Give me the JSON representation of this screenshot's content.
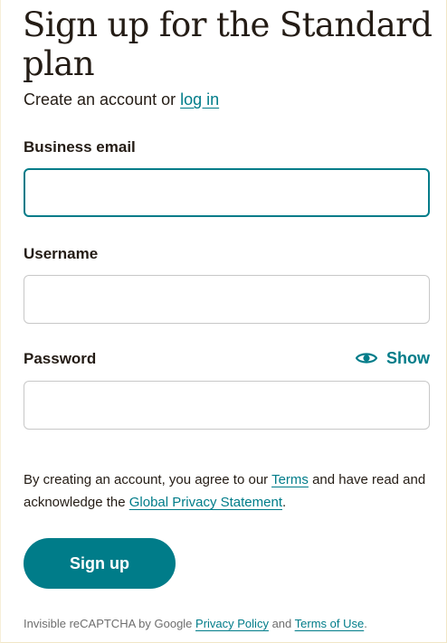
{
  "header": {
    "title": "Sign up for the Standard plan",
    "subtitle_text": "Create an account or ",
    "login_link": "log in"
  },
  "form": {
    "email": {
      "label": "Business email",
      "value": "",
      "placeholder": ""
    },
    "username": {
      "label": "Username",
      "value": "",
      "placeholder": ""
    },
    "password": {
      "label": "Password",
      "value": "",
      "placeholder": "",
      "toggle_label": "Show",
      "toggle_icon": "eye-icon"
    }
  },
  "legal": {
    "text_before": "By creating an account, you agree to our ",
    "terms_link": "Terms",
    "text_middle": " and have read and acknowledge the ",
    "privacy_link": "Global Privacy Statement",
    "text_after": "."
  },
  "submit": {
    "label": "Sign up"
  },
  "recaptcha": {
    "text_before": "Invisible reCAPTCHA by Google ",
    "privacy_link": "Privacy Policy",
    "text_middle": " and ",
    "terms_link": "Terms of Use",
    "text_after": "."
  },
  "colors": {
    "accent": "#007c89",
    "text": "#241c15",
    "muted": "#6e6e6e",
    "input_border": "#c8c8c8"
  }
}
